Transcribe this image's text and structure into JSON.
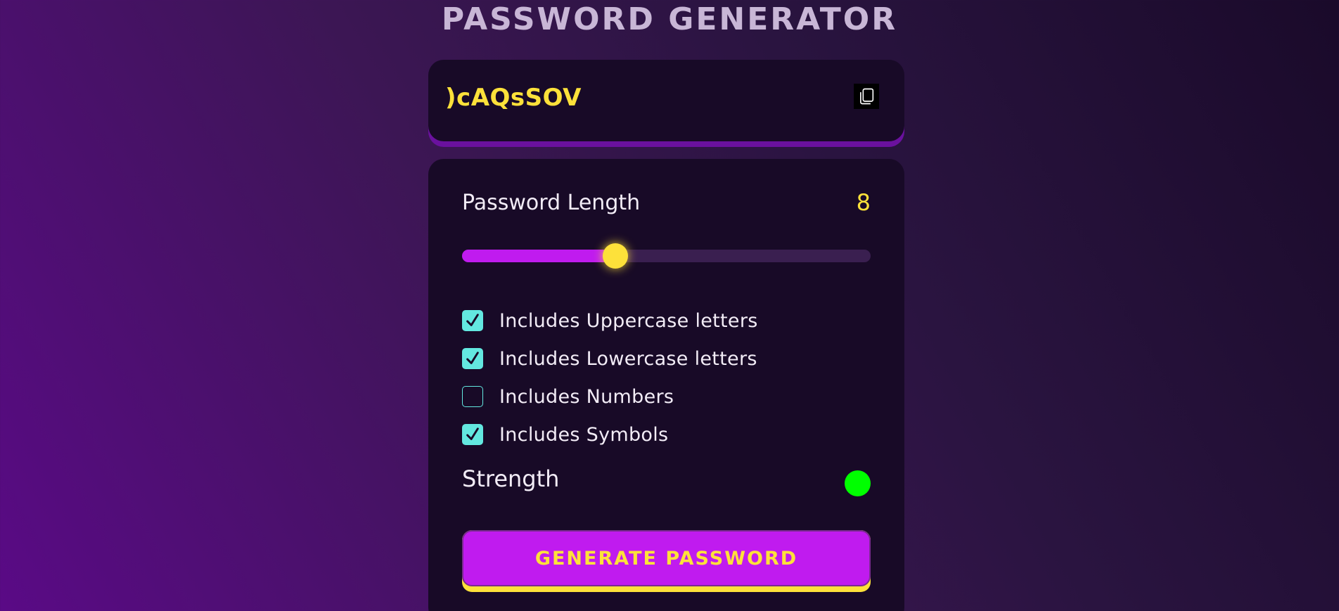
{
  "app": {
    "title": "PASSWORD GENERATOR"
  },
  "output": {
    "password": ")cAQsSOV",
    "copy_icon": "copy-icon"
  },
  "length": {
    "label": "Password Length",
    "value": "8",
    "slider_fraction": 0.375
  },
  "options": [
    {
      "label": "Includes Uppercase letters",
      "checked": true
    },
    {
      "label": "Includes Lowercase letters",
      "checked": true
    },
    {
      "label": "Includes Numbers",
      "checked": false
    },
    {
      "label": "Includes Symbols",
      "checked": true
    }
  ],
  "strength": {
    "label": "Strength",
    "color": "#00ff00"
  },
  "generate_button": {
    "label": "GENERATE PASSWORD"
  },
  "colors": {
    "accent_yellow": "#fde13a",
    "accent_purple": "#c01bef",
    "checkbox_teal": "#63e8e0",
    "panel_bg": "#180a27"
  }
}
